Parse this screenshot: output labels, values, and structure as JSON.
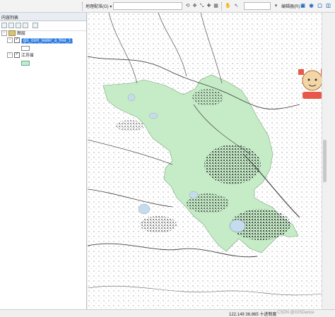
{
  "toolbar": {
    "georef_label": "地理配准(G) ▾",
    "editor_label": "编辑器(R) ▾"
  },
  "toc": {
    "title": "内容列表",
    "group_layer": "图层",
    "layers": [
      {
        "name": "gis_osm_water_a_free_1",
        "visible": true,
        "selected": true
      },
      {
        "name": "江苏省",
        "visible": true,
        "selected": false
      }
    ]
  },
  "colors": {
    "province_fill": "#c5ecc7",
    "water": "#333333",
    "selection": "#2f7de0"
  },
  "status": {
    "coords": "122.149  36.865 十进制度"
  },
  "watermark": "CSDN @GISDance"
}
